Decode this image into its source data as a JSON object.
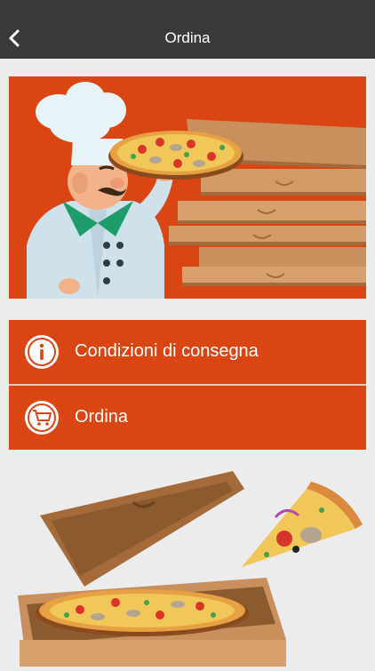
{
  "header": {
    "title": "Ordina",
    "back_icon": "chevron-left-icon"
  },
  "menu": {
    "items": [
      {
        "label": "Condizioni di consegna",
        "icon": "info-icon"
      },
      {
        "label": "Ordina",
        "icon": "shopping-cart-icon"
      }
    ]
  },
  "colors": {
    "topbar": "#3a3a3a",
    "accent": "#d94613",
    "background": "#ececec"
  }
}
